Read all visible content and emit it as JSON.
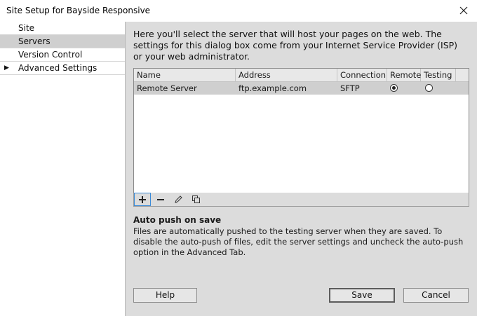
{
  "window": {
    "title": "Site Setup for Bayside Responsive"
  },
  "sidebar": {
    "items": [
      {
        "label": "Site"
      },
      {
        "label": "Servers",
        "selected": true
      },
      {
        "label": "Version Control"
      },
      {
        "label": "Advanced Settings",
        "expandable": true
      }
    ]
  },
  "main": {
    "intro": "Here you'll select the server that will host your pages on the web. The settings for this dialog box come from your Internet Service Provider (ISP) or your web administrator.",
    "table": {
      "columns": [
        "Name",
        "Address",
        "Connection",
        "Remote",
        "Testing"
      ],
      "rows": [
        {
          "name": "Remote Server",
          "address": "ftp.example.com",
          "connection": "SFTP",
          "remote": true,
          "testing": false
        }
      ]
    },
    "auto_push": {
      "heading": "Auto push on save",
      "text": "Files are automatically pushed to the testing server when they are saved. To disable the auto-push of files, edit the server settings and uncheck the auto-push option in the Advanced Tab."
    }
  },
  "buttons": {
    "help": "Help",
    "save": "Save",
    "cancel": "Cancel"
  },
  "colors": {
    "content_bg": "#dcdcdc",
    "selected_row": "#cfcfcf",
    "focus": "#3a8bd8"
  }
}
